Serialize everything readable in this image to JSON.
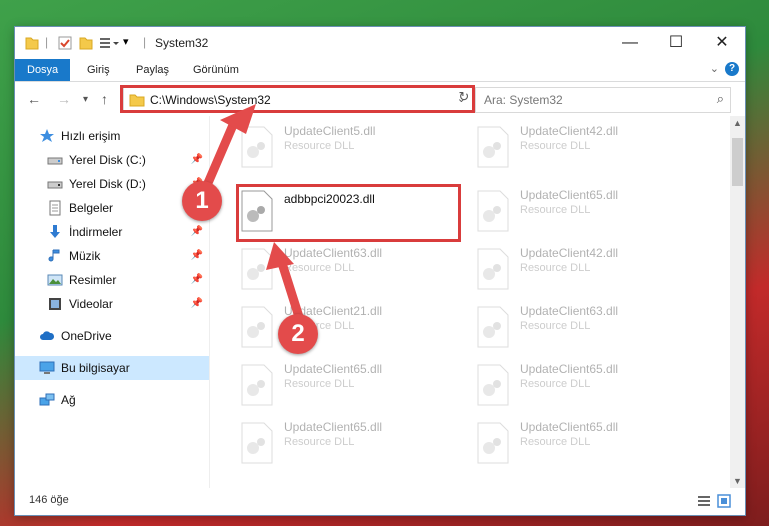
{
  "window": {
    "title": "System32",
    "controls": {
      "minimize": "—",
      "maximize": "☐",
      "close": "✕"
    }
  },
  "ribbon": {
    "tabs": [
      "Dosya",
      "Giriş",
      "Paylaş",
      "Görünüm"
    ],
    "help": "?",
    "collapse": "⌄"
  },
  "address": {
    "path": "C:\\Windows\\System32",
    "search_placeholder": "Ara: System32"
  },
  "sidebar": {
    "items": [
      {
        "label": "Hızlı erişim",
        "icon": "star-icon"
      },
      {
        "label": "Yerel Disk (C:)",
        "icon": "drive-icon",
        "pinned": true
      },
      {
        "label": "Yerel Disk (D:)",
        "icon": "drive-icon",
        "pinned": true
      },
      {
        "label": "Belgeler",
        "icon": "document-icon",
        "pinned": true
      },
      {
        "label": "İndirmeler",
        "icon": "download-icon",
        "pinned": true
      },
      {
        "label": "Müzik",
        "icon": "music-icon",
        "pinned": true
      },
      {
        "label": "Resimler",
        "icon": "pictures-icon",
        "pinned": true
      },
      {
        "label": "Videolar",
        "icon": "video-icon",
        "pinned": true
      },
      {
        "label": "OneDrive",
        "icon": "cloud-icon"
      },
      {
        "label": "Bu bilgisayar",
        "icon": "computer-icon",
        "selected": true
      },
      {
        "label": "Ağ",
        "icon": "network-icon"
      }
    ]
  },
  "files": [
    {
      "name": "UpdateClient5.dll",
      "desc": "Resource DLL"
    },
    {
      "name": "UpdateClient42.dll",
      "desc": "Resource DLL"
    },
    {
      "name": "adbbpci20023.dll",
      "desc": ""
    },
    {
      "name": "UpdateClient65.dll",
      "desc": "Resource DLL"
    },
    {
      "name": "UpdateClient63.dll",
      "desc": "Resource DLL"
    },
    {
      "name": "UpdateClient42.dll",
      "desc": "Resource DLL"
    },
    {
      "name": "UpdateClient21.dll",
      "desc": "Resource DLL"
    },
    {
      "name": "UpdateClient63.dll",
      "desc": "Resource DLL"
    },
    {
      "name": "UpdateClient65.dll",
      "desc": "Resource DLL"
    },
    {
      "name": "UpdateClient65.dll",
      "desc": "Resource DLL"
    },
    {
      "name": "UpdateClient65.dll",
      "desc": "Resource DLL"
    },
    {
      "name": "UpdateClient65.dll",
      "desc": "Resource DLL"
    }
  ],
  "status": {
    "count": "146 öğe"
  },
  "annotations": {
    "step1": "1",
    "step2": "2"
  },
  "colors": {
    "accent": "#1979ca",
    "highlight": "#d93c3c",
    "selected": "#cce8ff"
  }
}
